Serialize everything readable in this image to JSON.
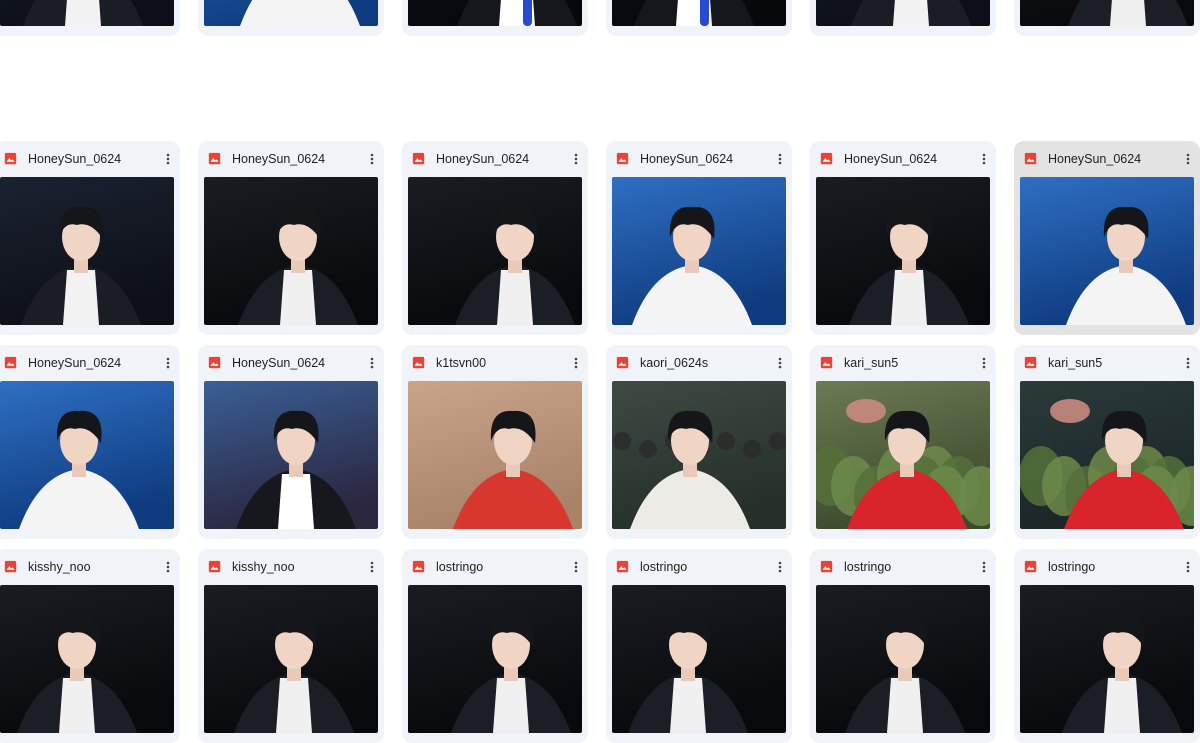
{
  "colors": {
    "card_bg": "#f0f4f9",
    "card_selected_bg": "#e3e3e3",
    "image_icon": "#ea4335",
    "text": "#1f1f1f"
  },
  "rows": [
    {
      "cards": [
        {
          "name": "",
          "icon": "image-file-icon",
          "scene": "dark-stage"
        },
        {
          "name": "",
          "icon": "image-file-icon",
          "scene": "blue-stage"
        },
        {
          "name": "",
          "icon": "image-file-icon",
          "scene": "dark-mic"
        },
        {
          "name": "",
          "icon": "image-file-icon",
          "scene": "dark-mic"
        },
        {
          "name": "",
          "icon": "image-file-icon",
          "scene": "dark-stage"
        },
        {
          "name": "",
          "icon": "image-file-icon",
          "scene": "dark-portrait"
        }
      ]
    },
    {
      "cards": [
        {
          "name": "HoneySun_0624",
          "icon": "image-file-icon",
          "scene": "dark-stage"
        },
        {
          "name": "HoneySun_0624",
          "icon": "image-file-icon",
          "scene": "dark-portrait"
        },
        {
          "name": "HoneySun_0624",
          "icon": "image-file-icon",
          "scene": "dark-portrait"
        },
        {
          "name": "HoneySun_0624",
          "icon": "image-file-icon",
          "scene": "blue-stage"
        },
        {
          "name": "HoneySun_0624",
          "icon": "image-file-icon",
          "scene": "dark-portrait"
        },
        {
          "name": "HoneySun_0624",
          "icon": "image-file-icon",
          "scene": "blue-stage",
          "selected": true
        }
      ]
    },
    {
      "cards": [
        {
          "name": "HoneySun_0624",
          "icon": "image-file-icon",
          "scene": "blue-stage"
        },
        {
          "name": "HoneySun_0624",
          "icon": "image-file-icon",
          "scene": "blue-portrait"
        },
        {
          "name": "k1tsvn00",
          "icon": "image-file-icon",
          "scene": "warm-blur"
        },
        {
          "name": "kaori_0624s",
          "icon": "image-file-icon",
          "scene": "crowd"
        },
        {
          "name": "kari_sun5",
          "icon": "image-file-icon",
          "scene": "garden"
        },
        {
          "name": "kari_sun5",
          "icon": "image-file-icon",
          "scene": "garden-dark"
        }
      ]
    },
    {
      "cards": [
        {
          "name": "kisshy_noo",
          "icon": "image-file-icon",
          "scene": "dark-portrait"
        },
        {
          "name": "kisshy_noo",
          "icon": "image-file-icon",
          "scene": "dark-portrait"
        },
        {
          "name": "lostringo",
          "icon": "image-file-icon",
          "scene": "dark-portrait"
        },
        {
          "name": "lostringo",
          "icon": "image-file-icon",
          "scene": "dark-portrait"
        },
        {
          "name": "lostringo",
          "icon": "image-file-icon",
          "scene": "dark-portrait"
        },
        {
          "name": "lostringo",
          "icon": "image-file-icon",
          "scene": "dark-portrait"
        }
      ]
    }
  ]
}
